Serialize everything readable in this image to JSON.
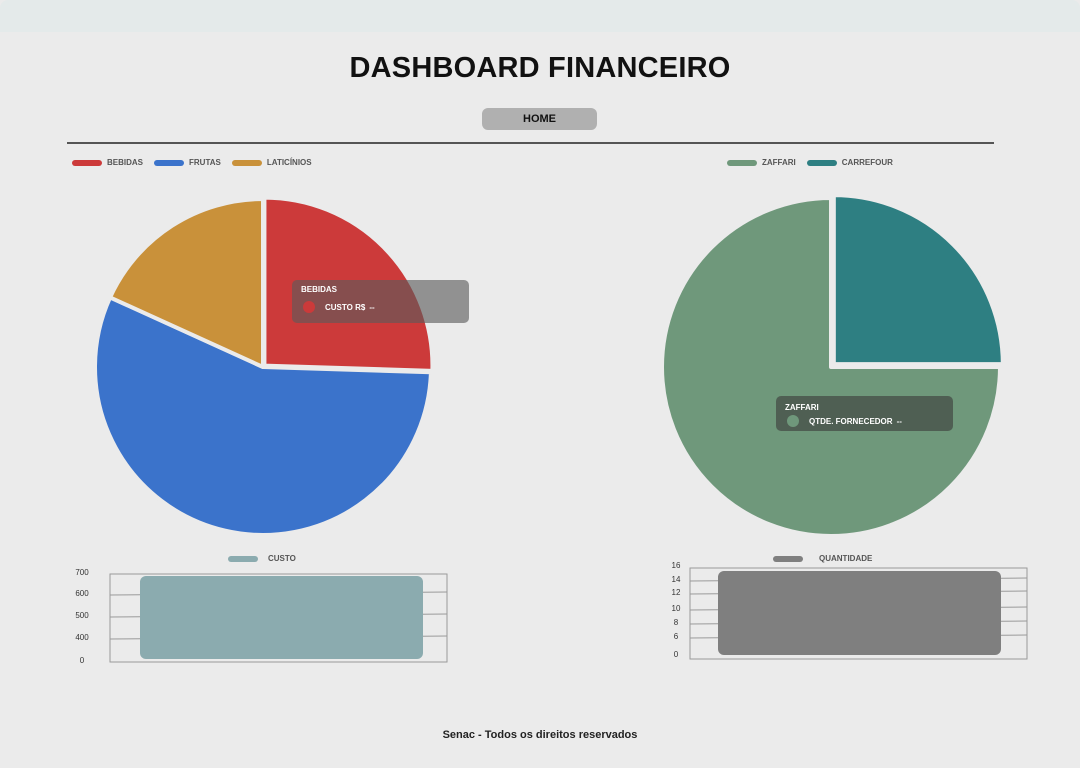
{
  "header": {
    "title": "DASHBOARD FINANCEIRO",
    "home_label": "HOME"
  },
  "colors": {
    "bebidas": "#cc3a3a",
    "frutas": "#3b73cb",
    "laticinios": "#c9913a",
    "zaffari": "#6f987b",
    "carrefour": "#2e7f82",
    "custo_bar": "#8babaf",
    "quantidade_bar": "#7f7f7f"
  },
  "chart_data": [
    {
      "type": "pie",
      "legend_position": "top-left",
      "slices": [
        {
          "label": "BEBIDAS",
          "value": 25.5,
          "color": "#cc3a3a"
        },
        {
          "label": "FRUTAS",
          "value": 56.3,
          "color": "#3b73cb"
        },
        {
          "label": "LATICÍNIOS",
          "value": 18.2,
          "color": "#c9913a"
        }
      ],
      "tooltip": {
        "title": "BEBIDAS",
        "label": "CUSTO R$",
        "value": "--"
      }
    },
    {
      "type": "pie",
      "legend_position": "top-center",
      "slices": [
        {
          "label": "CARREFOUR",
          "value": 25,
          "color": "#2e7f82"
        },
        {
          "label": "ZAFFARI",
          "value": 75,
          "color": "#6f987b"
        }
      ],
      "tooltip": {
        "title": "ZAFFARI",
        "label": "QTDE. FORNECEDOR",
        "value": "--"
      }
    },
    {
      "type": "bar",
      "series": [
        {
          "name": "CUSTO",
          "values": [
            700
          ],
          "color": "#8babaf"
        }
      ],
      "y_ticks": [
        "700",
        "600",
        "500",
        "400",
        "0"
      ],
      "grid": true
    },
    {
      "type": "bar",
      "series": [
        {
          "name": "QUANTIDADE",
          "values": [
            16
          ],
          "color": "#7f7f7f"
        }
      ],
      "y_ticks": [
        "16",
        "14",
        "12",
        "10",
        "8",
        "6",
        "0"
      ],
      "grid": true
    }
  ],
  "footer": {
    "text": "Senac - Todos os direitos reservados"
  }
}
